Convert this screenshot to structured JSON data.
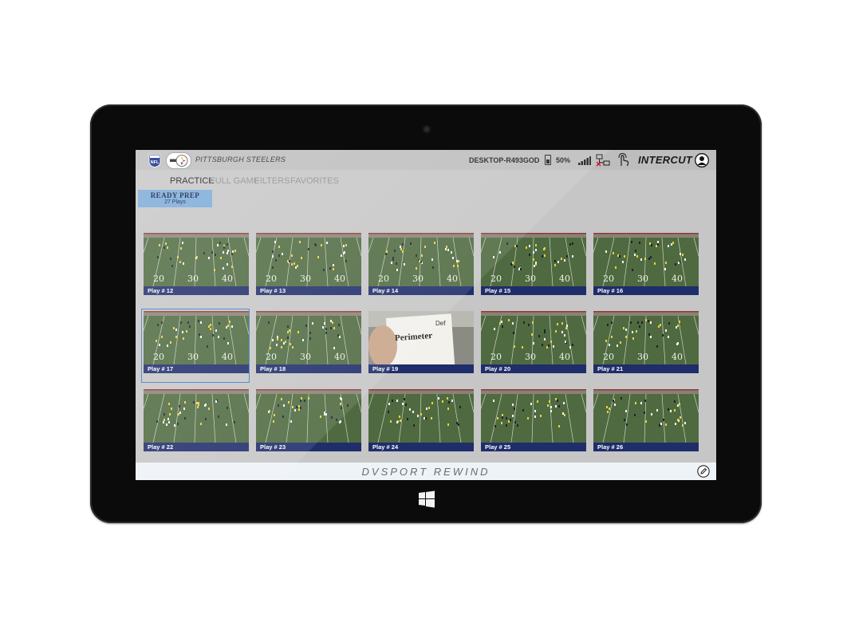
{
  "header": {
    "team_name": "PITTSBURGH STEELERS",
    "device_name": "DESKTOP-R493GOD",
    "battery": "50%",
    "brand": "INTERCUT"
  },
  "tabs": [
    {
      "label": "PRACTICE",
      "active": true
    },
    {
      "label": "FULL GAME",
      "active": false
    },
    {
      "label": "FILTERS",
      "active": false
    },
    {
      "label": "FAVORITES",
      "active": false
    }
  ],
  "playlist": {
    "title": "READY PREP",
    "subtitle": "27 Plays"
  },
  "plays": [
    {
      "label": "Play # 12"
    },
    {
      "label": "Play # 13"
    },
    {
      "label": "Play # 14"
    },
    {
      "label": "Play # 15"
    },
    {
      "label": "Play # 16"
    },
    {
      "label": "Play # 17"
    },
    {
      "label": "Play # 18"
    },
    {
      "label": "Play # 19",
      "card_top": "Def",
      "card_main": "Perimeter"
    },
    {
      "label": "Play # 20"
    },
    {
      "label": "Play # 21"
    },
    {
      "label": "Play # 22"
    },
    {
      "label": "Play # 23"
    },
    {
      "label": "Play # 24"
    },
    {
      "label": "Play # 25"
    },
    {
      "label": "Play # 26"
    }
  ],
  "field_numbers": [
    "20",
    "30",
    "40"
  ],
  "selected_play": "Play # 17",
  "footer": {
    "title": "DVSPORT REWIND"
  },
  "icons": [
    "nfl-logo-icon",
    "steelers-logo-icon",
    "battery-icon",
    "signal-icon",
    "network-icon",
    "touch-icon",
    "user-icon",
    "edit-icon",
    "windows-icon"
  ],
  "colors": {
    "label_bar": "#1f2d6b",
    "playlist_bg": "#7aaad8",
    "selection": "#3e7fc9",
    "field": "#4e6b3f"
  }
}
